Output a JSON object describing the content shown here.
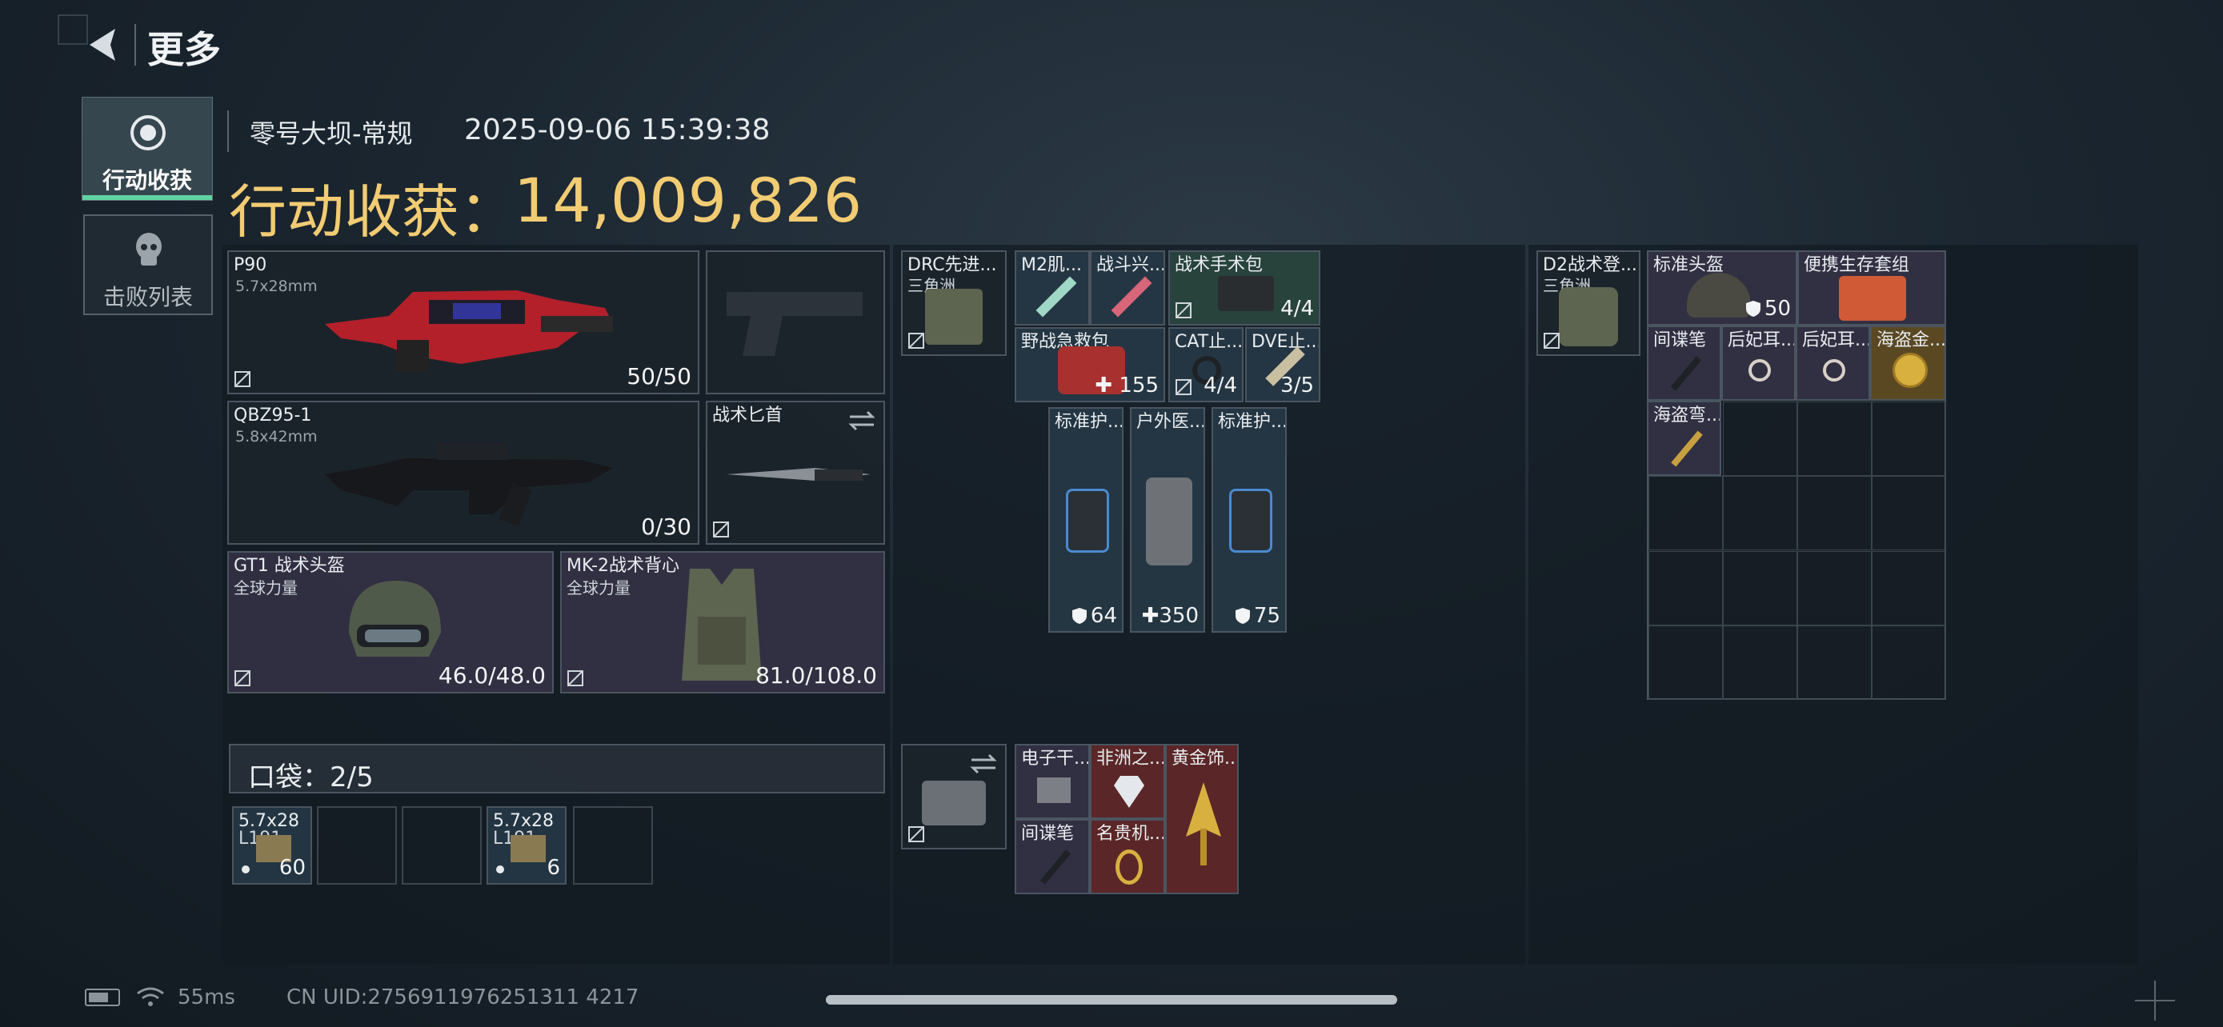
{
  "header": {
    "title": "更多"
  },
  "sidebar": {
    "tabs": [
      {
        "label": "行动收获"
      },
      {
        "label": "击败列表"
      }
    ]
  },
  "match": {
    "map": "零号大坝-常规",
    "datetime": "2025-09-06 15:39:38"
  },
  "summary": {
    "label": "行动收获：",
    "value": "14,009,826"
  },
  "weapons": {
    "primary": {
      "name": "P90",
      "caliber": "5.7x28mm",
      "ammo": "50/50"
    },
    "secondary": {
      "name": "QBZ95-1",
      "caliber": "5.8x42mm",
      "ammo": "0/30"
    },
    "melee": {
      "name": "战术匕首"
    }
  },
  "armor": {
    "helmet": {
      "name": "GT1 战术头盔",
      "brand": "全球力量",
      "durability": "46.0/48.0"
    },
    "vest": {
      "name": "MK-2战术背心",
      "brand": "全球力量",
      "durability": "81.0/108.0"
    }
  },
  "pocket": {
    "label": "口袋：2/5",
    "items": [
      {
        "name": "5.7x28",
        "sub": "L191",
        "count": "60"
      },
      {
        "name": "",
        "sub": "",
        "count": ""
      },
      {
        "name": "",
        "sub": "",
        "count": ""
      },
      {
        "name": "5.7x28",
        "sub": "L191",
        "count": "6"
      },
      {
        "name": "",
        "sub": "",
        "count": ""
      }
    ]
  },
  "rig": {
    "name": "DRC先进...",
    "sub": "三角洲",
    "items": [
      {
        "name": "M2肌..."
      },
      {
        "name": "战斗兴..."
      },
      {
        "name": "战术手术包",
        "count": "4/4"
      },
      {
        "name": "野战急救包",
        "count": "155"
      },
      {
        "name": "CAT止...",
        "count": "4/4"
      },
      {
        "name": "DVE止...",
        "count": "3/5"
      },
      {
        "name": "标准护...",
        "count": "64"
      },
      {
        "name": "户外医...",
        "count": "350"
      },
      {
        "name": "标准护...",
        "count": "75"
      }
    ]
  },
  "case": {
    "items": [
      {
        "name": "电子干..."
      },
      {
        "name": "非洲之..."
      },
      {
        "name": "黄金饰..."
      },
      {
        "name": "间谍笔"
      },
      {
        "name": "名贵机..."
      }
    ]
  },
  "backpack": {
    "name": "D2战术登...",
    "sub": "三角洲",
    "items": [
      {
        "name": "标准头盔",
        "count": "50"
      },
      {
        "name": "便携生存套组"
      },
      {
        "name": "间谍笔"
      },
      {
        "name": "后妃耳..."
      },
      {
        "name": "后妃耳..."
      },
      {
        "name": "海盗金..."
      },
      {
        "name": "海盗弯..."
      }
    ]
  },
  "status": {
    "ping": "55ms",
    "uid": "CN UID:2756911976251311 4217"
  },
  "colors": {
    "accent_gold": "#f2cc73",
    "active_tab_line": "#5fd3a3"
  }
}
